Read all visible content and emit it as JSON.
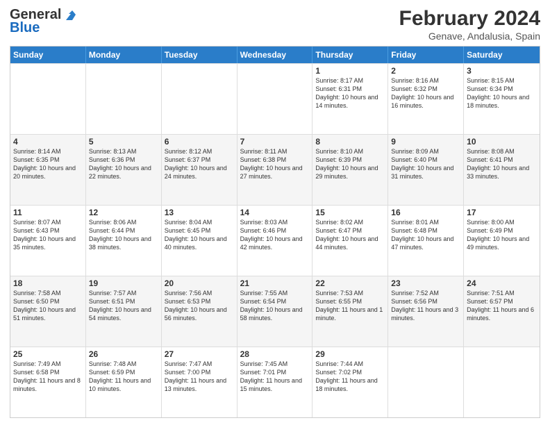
{
  "logo": {
    "general": "General",
    "blue": "Blue"
  },
  "title": {
    "month_year": "February 2024",
    "subtitle": "Genave, Andalusia, Spain"
  },
  "days": [
    "Sunday",
    "Monday",
    "Tuesday",
    "Wednesday",
    "Thursday",
    "Friday",
    "Saturday"
  ],
  "weeks": [
    [
      {
        "day": "",
        "info": ""
      },
      {
        "day": "",
        "info": ""
      },
      {
        "day": "",
        "info": ""
      },
      {
        "day": "",
        "info": ""
      },
      {
        "day": "1",
        "info": "Sunrise: 8:17 AM\nSunset: 6:31 PM\nDaylight: 10 hours and 14 minutes."
      },
      {
        "day": "2",
        "info": "Sunrise: 8:16 AM\nSunset: 6:32 PM\nDaylight: 10 hours and 16 minutes."
      },
      {
        "day": "3",
        "info": "Sunrise: 8:15 AM\nSunset: 6:34 PM\nDaylight: 10 hours and 18 minutes."
      }
    ],
    [
      {
        "day": "4",
        "info": "Sunrise: 8:14 AM\nSunset: 6:35 PM\nDaylight: 10 hours and 20 minutes."
      },
      {
        "day": "5",
        "info": "Sunrise: 8:13 AM\nSunset: 6:36 PM\nDaylight: 10 hours and 22 minutes."
      },
      {
        "day": "6",
        "info": "Sunrise: 8:12 AM\nSunset: 6:37 PM\nDaylight: 10 hours and 24 minutes."
      },
      {
        "day": "7",
        "info": "Sunrise: 8:11 AM\nSunset: 6:38 PM\nDaylight: 10 hours and 27 minutes."
      },
      {
        "day": "8",
        "info": "Sunrise: 8:10 AM\nSunset: 6:39 PM\nDaylight: 10 hours and 29 minutes."
      },
      {
        "day": "9",
        "info": "Sunrise: 8:09 AM\nSunset: 6:40 PM\nDaylight: 10 hours and 31 minutes."
      },
      {
        "day": "10",
        "info": "Sunrise: 8:08 AM\nSunset: 6:41 PM\nDaylight: 10 hours and 33 minutes."
      }
    ],
    [
      {
        "day": "11",
        "info": "Sunrise: 8:07 AM\nSunset: 6:43 PM\nDaylight: 10 hours and 35 minutes."
      },
      {
        "day": "12",
        "info": "Sunrise: 8:06 AM\nSunset: 6:44 PM\nDaylight: 10 hours and 38 minutes."
      },
      {
        "day": "13",
        "info": "Sunrise: 8:04 AM\nSunset: 6:45 PM\nDaylight: 10 hours and 40 minutes."
      },
      {
        "day": "14",
        "info": "Sunrise: 8:03 AM\nSunset: 6:46 PM\nDaylight: 10 hours and 42 minutes."
      },
      {
        "day": "15",
        "info": "Sunrise: 8:02 AM\nSunset: 6:47 PM\nDaylight: 10 hours and 44 minutes."
      },
      {
        "day": "16",
        "info": "Sunrise: 8:01 AM\nSunset: 6:48 PM\nDaylight: 10 hours and 47 minutes."
      },
      {
        "day": "17",
        "info": "Sunrise: 8:00 AM\nSunset: 6:49 PM\nDaylight: 10 hours and 49 minutes."
      }
    ],
    [
      {
        "day": "18",
        "info": "Sunrise: 7:58 AM\nSunset: 6:50 PM\nDaylight: 10 hours and 51 minutes."
      },
      {
        "day": "19",
        "info": "Sunrise: 7:57 AM\nSunset: 6:51 PM\nDaylight: 10 hours and 54 minutes."
      },
      {
        "day": "20",
        "info": "Sunrise: 7:56 AM\nSunset: 6:53 PM\nDaylight: 10 hours and 56 minutes."
      },
      {
        "day": "21",
        "info": "Sunrise: 7:55 AM\nSunset: 6:54 PM\nDaylight: 10 hours and 58 minutes."
      },
      {
        "day": "22",
        "info": "Sunrise: 7:53 AM\nSunset: 6:55 PM\nDaylight: 11 hours and 1 minute."
      },
      {
        "day": "23",
        "info": "Sunrise: 7:52 AM\nSunset: 6:56 PM\nDaylight: 11 hours and 3 minutes."
      },
      {
        "day": "24",
        "info": "Sunrise: 7:51 AM\nSunset: 6:57 PM\nDaylight: 11 hours and 6 minutes."
      }
    ],
    [
      {
        "day": "25",
        "info": "Sunrise: 7:49 AM\nSunset: 6:58 PM\nDaylight: 11 hours and 8 minutes."
      },
      {
        "day": "26",
        "info": "Sunrise: 7:48 AM\nSunset: 6:59 PM\nDaylight: 11 hours and 10 minutes."
      },
      {
        "day": "27",
        "info": "Sunrise: 7:47 AM\nSunset: 7:00 PM\nDaylight: 11 hours and 13 minutes."
      },
      {
        "day": "28",
        "info": "Sunrise: 7:45 AM\nSunset: 7:01 PM\nDaylight: 11 hours and 15 minutes."
      },
      {
        "day": "29",
        "info": "Sunrise: 7:44 AM\nSunset: 7:02 PM\nDaylight: 11 hours and 18 minutes."
      },
      {
        "day": "",
        "info": ""
      },
      {
        "day": "",
        "info": ""
      }
    ]
  ]
}
